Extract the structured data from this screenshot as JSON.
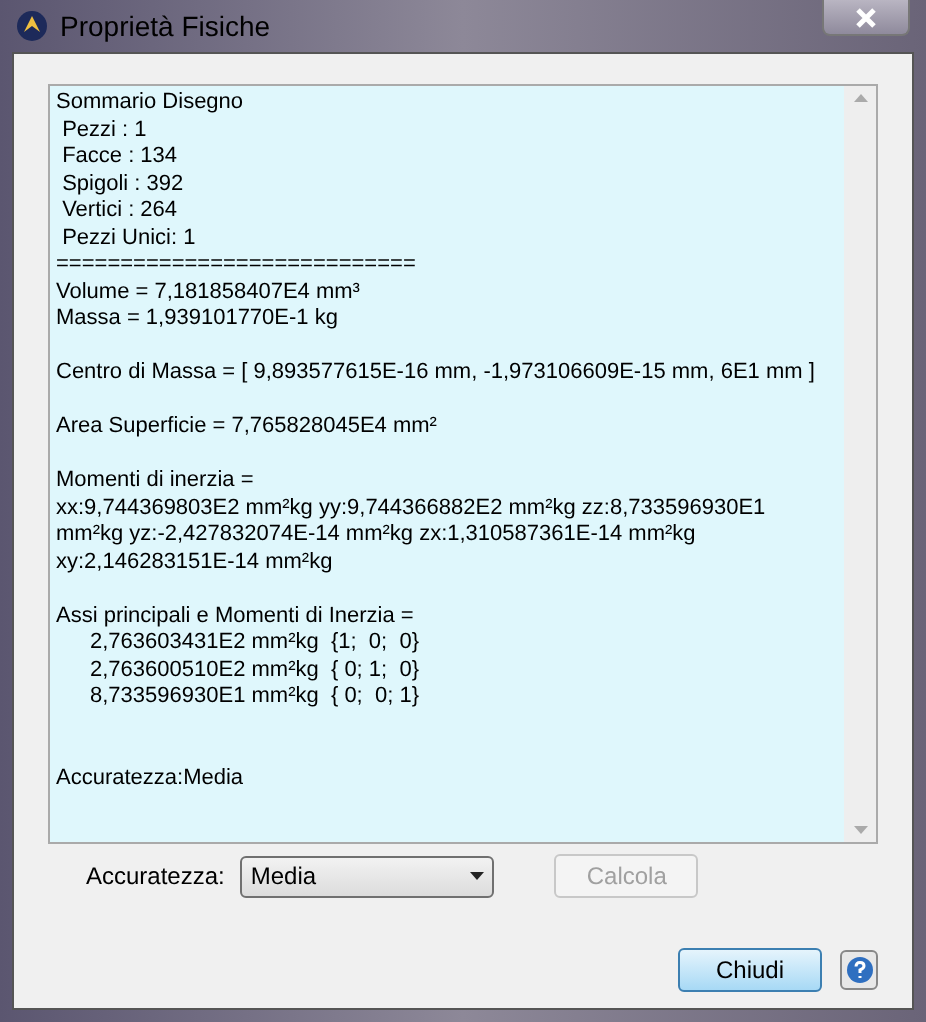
{
  "window": {
    "title": "Proprietà Fisiche"
  },
  "report": [
    {
      "kind": "plain",
      "lines": [
        "Sommario Disegno",
        " Pezzi : 1",
        " Facce : 134",
        " Spigoli : 392",
        " Vertici : 264",
        " Pezzi Unici: 1",
        "============================",
        "Volume = 7,181858407E4 mm³",
        "Massa = 1,939101770E-1 kg"
      ]
    },
    {
      "kind": "plain",
      "lines": [
        "Centro di Massa = [ 9,893577615E-16 mm, -1,973106609E-15 mm, 6E1 mm ]"
      ]
    },
    {
      "kind": "plain",
      "lines": [
        "Area Superficie = 7,765828045E4 mm²"
      ]
    },
    {
      "kind": "plain",
      "lines": [
        "Momenti di inerzia =",
        "xx:9,744369803E2 mm²kg yy:9,744366882E2 mm²kg zz:8,733596930E1 mm²kg yz:-2,427832074E-14 mm²kg zx:1,310587361E-14 mm²kg xy:2,146283151E-14 mm²kg"
      ]
    },
    {
      "kind": "plain",
      "lines": [
        "Assi principali e Momenti di Inerzia ="
      ]
    },
    {
      "kind": "indented",
      "lines": [
        "2,763603431E2 mm²kg  {1;  0;  0}",
        "2,763600510E2 mm²kg  { 0; 1;  0}",
        "8,733596930E1 mm²kg  { 0;  0; 1}"
      ]
    },
    {
      "kind": "spaced",
      "lines": [
        "Accuratezza:Media"
      ]
    }
  ],
  "accuracy": {
    "label": "Accuratezza:",
    "value": "Media"
  },
  "buttons": [
    {
      "label": "Calcola",
      "disabled": true
    },
    {
      "label": "Chiudi",
      "disabled": false
    }
  ]
}
